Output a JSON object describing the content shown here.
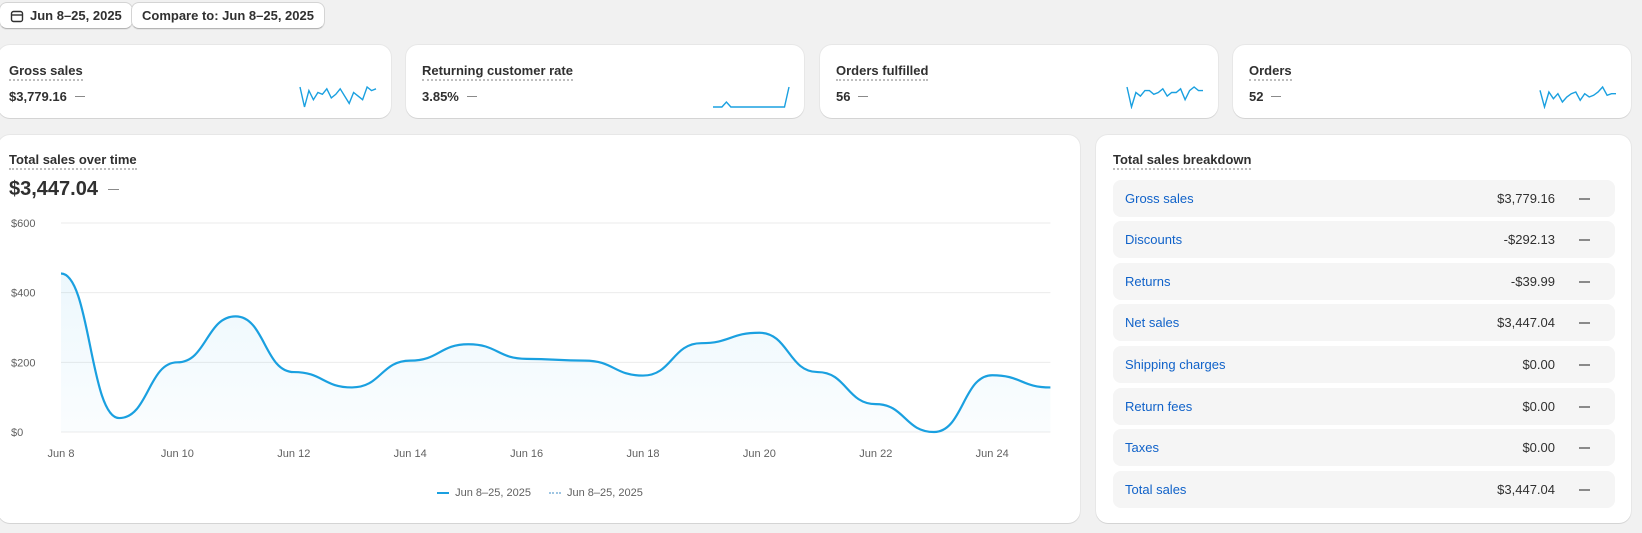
{
  "toolbar": {
    "date_range_label": "Jun 8–25, 2025",
    "compare_label": "Compare to: Jun 8–25, 2025"
  },
  "colors": {
    "accent": "#1aa0e0",
    "link": "#1062c9",
    "background": "#f1f1f1"
  },
  "kpis": [
    {
      "label": "Gross sales",
      "value": "$3,779.16",
      "change": "—",
      "spark": [
        13,
        2,
        11,
        6,
        10,
        9,
        12,
        7,
        9,
        12,
        8,
        4,
        10,
        8,
        6,
        13,
        11,
        12
      ]
    },
    {
      "label": "Returning customer rate",
      "value": "3.85%",
      "change": "—",
      "spark": [
        0,
        0,
        0,
        5,
        0,
        0,
        0,
        0,
        0,
        0,
        0,
        0,
        0,
        0,
        0,
        0,
        0,
        20
      ]
    },
    {
      "label": "Orders fulfilled",
      "value": "56",
      "change": "—",
      "spark": [
        13,
        2,
        10,
        8,
        11,
        11,
        9,
        10,
        12,
        8,
        10,
        10,
        12,
        6,
        11,
        13,
        11,
        11
      ]
    },
    {
      "label": "Orders",
      "value": "52",
      "change": "—",
      "spark": [
        12,
        2,
        11,
        7,
        10,
        5,
        8,
        10,
        11,
        6,
        10,
        8,
        9,
        11,
        14,
        9,
        10,
        10
      ]
    }
  ],
  "sales_chart": {
    "title": "Total sales over time",
    "total": "$3,447.04",
    "change": "—",
    "legend": [
      "Jun 8–25, 2025",
      "Jun 8–25, 2025"
    ]
  },
  "chart_data": {
    "type": "area",
    "x": [
      "Jun 8",
      "Jun 9",
      "Jun 10",
      "Jun 11",
      "Jun 12",
      "Jun 13",
      "Jun 14",
      "Jun 15",
      "Jun 16",
      "Jun 17",
      "Jun 18",
      "Jun 19",
      "Jun 20",
      "Jun 21",
      "Jun 22",
      "Jun 23",
      "Jun 24",
      "Jun 25"
    ],
    "x_ticks": [
      "Jun 8",
      "Jun 10",
      "Jun 12",
      "Jun 14",
      "Jun 16",
      "Jun 18",
      "Jun 20",
      "Jun 22",
      "Jun 24"
    ],
    "series": [
      {
        "name": "Jun 8–25, 2025",
        "values": [
          455,
          40,
          200,
          332,
          172,
          128,
          205,
          252,
          210,
          205,
          162,
          255,
          285,
          172,
          80,
          0,
          163,
          128
        ]
      }
    ],
    "ylim": [
      0,
      600
    ],
    "y_ticks": [
      "$0",
      "$200",
      "$400",
      "$600"
    ],
    "grid": true,
    "legend_position": "bottom-center"
  },
  "breakdown": {
    "title": "Total sales breakdown",
    "rows": [
      {
        "label": "Gross sales",
        "amount": "$3,779.16",
        "change": "—"
      },
      {
        "label": "Discounts",
        "amount": "-$292.13",
        "change": "—"
      },
      {
        "label": "Returns",
        "amount": "-$39.99",
        "change": "—"
      },
      {
        "label": "Net sales",
        "amount": "$3,447.04",
        "change": "—"
      },
      {
        "label": "Shipping charges",
        "amount": "$0.00",
        "change": "—"
      },
      {
        "label": "Return fees",
        "amount": "$0.00",
        "change": "—"
      },
      {
        "label": "Taxes",
        "amount": "$0.00",
        "change": "—"
      },
      {
        "label": "Total sales",
        "amount": "$3,447.04",
        "change": "—"
      }
    ]
  }
}
